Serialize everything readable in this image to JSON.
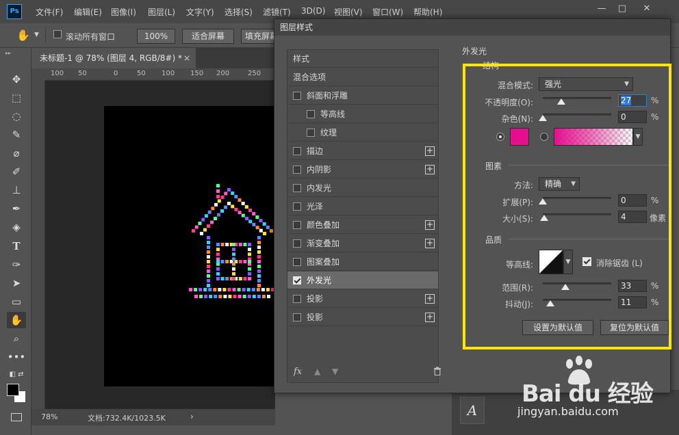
{
  "app": {
    "logo": "Ps",
    "menu": [
      "文件(F)",
      "编辑(E)",
      "图像(I)",
      "图层(L)",
      "文字(Y)",
      "选择(S)",
      "滤镜(T)",
      "3D(D)",
      "视图(V)",
      "窗口(W)",
      "帮助(H)"
    ],
    "window_buttons": [
      "—",
      "□",
      "✕"
    ]
  },
  "options_bar": {
    "scroll_all_windows": "滚动所有窗口",
    "zoom_value": "100%",
    "fit_screen": "适合屏幕",
    "fill_screen": "填充屏幕"
  },
  "document": {
    "tab_title": "未标题-1 @ 78% (图层 4, RGB/8#) *",
    "tab_close": "×",
    "ruler_marks": [
      "100",
      "50",
      "0",
      "50",
      "100",
      "150",
      "200",
      "250"
    ],
    "zoom": "78%",
    "doc_size": "文档:732.4K/1023.5K",
    "status_arrow": "›"
  },
  "dialog": {
    "title": "图层样式",
    "styles": [
      {
        "label": "样式",
        "checkbox": false,
        "plus": false,
        "checked": false
      },
      {
        "label": "混合选项",
        "checkbox": false,
        "plus": false,
        "checked": false
      },
      {
        "label": "斜面和浮雕",
        "checkbox": true,
        "plus": false,
        "checked": false
      },
      {
        "label": "等高线",
        "checkbox": true,
        "plus": false,
        "checked": false,
        "sub": true
      },
      {
        "label": "纹理",
        "checkbox": true,
        "plus": false,
        "checked": false,
        "sub": true
      },
      {
        "label": "描边",
        "checkbox": true,
        "plus": true,
        "checked": false
      },
      {
        "label": "内阴影",
        "checkbox": true,
        "plus": true,
        "checked": false
      },
      {
        "label": "内发光",
        "checkbox": true,
        "plus": false,
        "checked": false
      },
      {
        "label": "光泽",
        "checkbox": true,
        "plus": false,
        "checked": false
      },
      {
        "label": "颜色叠加",
        "checkbox": true,
        "plus": true,
        "checked": false
      },
      {
        "label": "渐变叠加",
        "checkbox": true,
        "plus": true,
        "checked": false
      },
      {
        "label": "图案叠加",
        "checkbox": true,
        "plus": false,
        "checked": false
      },
      {
        "label": "外发光",
        "checkbox": true,
        "plus": false,
        "checked": true,
        "selected": true
      },
      {
        "label": "投影",
        "checkbox": true,
        "plus": true,
        "checked": false
      },
      {
        "label": "投影",
        "checkbox": true,
        "plus": true,
        "checked": false
      }
    ],
    "fx_label": "fx",
    "fx_up": "▲",
    "fx_down": "▼",
    "fx_trash": "🗑",
    "outer_glow": {
      "heading": "外发光",
      "structure": {
        "heading": "结构",
        "blend_mode_label": "混合模式:",
        "blend_mode_value": "强光",
        "opacity_label": "不透明度(O):",
        "opacity_value": "27",
        "opacity_unit": "%",
        "opacity_fraction": 0.27,
        "noise_label": "杂色(N):",
        "noise_value": "0",
        "noise_unit": "%",
        "noise_fraction": 0.0,
        "glow_color": "#e3108e"
      },
      "elements": {
        "heading": "图素",
        "technique_label": "方法:",
        "technique_value": "精确",
        "spread_label": "扩展(P):",
        "spread_value": "0",
        "spread_unit": "%",
        "spread_fraction": 0.0,
        "size_label": "大小(S):",
        "size_value": "4",
        "size_unit": "像素",
        "size_fraction": 0.02
      },
      "quality": {
        "heading": "品质",
        "contour_label": "等高线:",
        "antialias_label": "消除锯齿 (L)",
        "range_label": "范围(R):",
        "range_value": "33",
        "range_unit": "%",
        "range_fraction": 0.33,
        "jitter_label": "抖动(J):",
        "jitter_value": "11",
        "jitter_unit": "%",
        "jitter_fraction": 0.11
      },
      "make_default": "设置为默认值",
      "reset_default": "复位为默认值"
    }
  },
  "type_icon": "A",
  "watermark": {
    "main": "Bai du 经验",
    "sub": "jingyan.baidu.com"
  },
  "colors": {
    "highlight": "#ffe600",
    "glow": "#e3108e"
  }
}
